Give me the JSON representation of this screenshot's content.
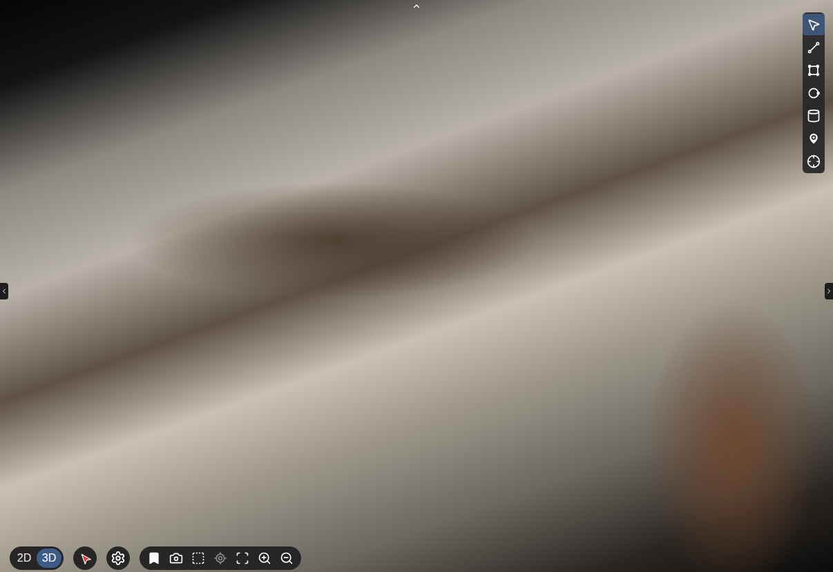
{
  "view_modes": [
    {
      "label": "2D",
      "selected": false
    },
    {
      "label": "3D",
      "selected": true
    }
  ],
  "measure_tools": [
    {
      "kind": "select",
      "selected": true
    },
    {
      "kind": "distance",
      "selected": false
    },
    {
      "kind": "area",
      "selected": false
    },
    {
      "kind": "circle",
      "selected": false
    },
    {
      "kind": "volume",
      "selected": false
    },
    {
      "kind": "marker",
      "selected": false
    },
    {
      "kind": "point",
      "selected": false
    }
  ],
  "view_tools": [
    {
      "kind": "bookmark",
      "disabled": false
    },
    {
      "kind": "screenshot",
      "disabled": false
    },
    {
      "kind": "select-area",
      "disabled": false
    },
    {
      "kind": "locate",
      "disabled": true
    },
    {
      "kind": "fit",
      "disabled": false
    },
    {
      "kind": "zoom-in",
      "disabled": false
    },
    {
      "kind": "zoom-out",
      "disabled": false
    }
  ]
}
